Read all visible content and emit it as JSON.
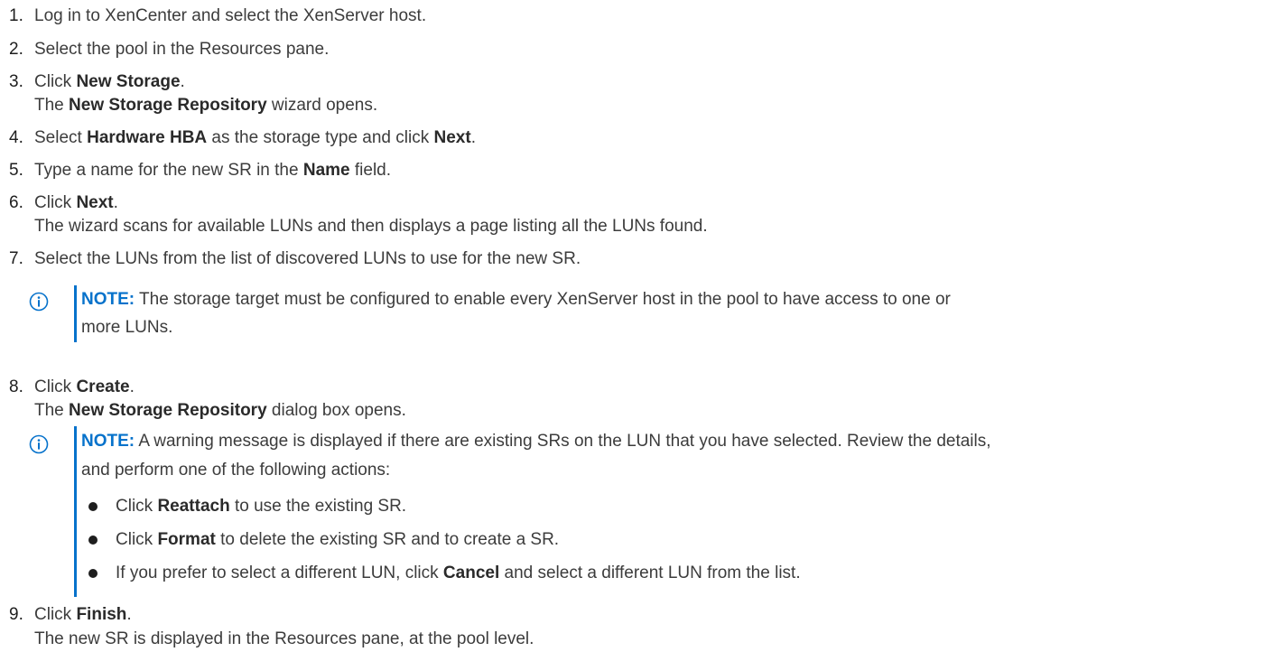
{
  "steps": [
    {
      "number": "1.",
      "text": "Log in to XenCenter and select the XenServer host."
    },
    {
      "number": "2.",
      "text": "Select the pool in the Resources pane."
    },
    {
      "number": "3.",
      "pre": "Click ",
      "bold": "New Storage",
      "post": ".",
      "sub": {
        "pre": "The ",
        "bold": "New Storage Repository",
        "post": " wizard opens."
      }
    },
    {
      "number": "4.",
      "pre": "Select ",
      "bold": "Hardware HBA",
      "mid": " as the storage type and click ",
      "bold2": "Next",
      "post": "."
    },
    {
      "number": "5.",
      "pre": "Type a name for the new SR in the ",
      "bold": "Name",
      "post": " field."
    },
    {
      "number": "6.",
      "pre": "Click ",
      "bold": "Next",
      "post": ".",
      "sub": "The wizard scans for available LUNs and then displays a page listing all the LUNs found."
    },
    {
      "number": "7.",
      "text": "Select the LUNs from the list of discovered LUNs to use for the new SR."
    },
    {
      "number": "8.",
      "pre": "Click ",
      "bold": "Create",
      "post": ".",
      "sub": {
        "pre": "The ",
        "bold": "New Storage Repository",
        "post": " dialog box opens."
      }
    },
    {
      "number": "9.",
      "pre": "Click ",
      "bold": "Finish",
      "post": ".",
      "sub": "The new SR is displayed in the Resources pane, at the pool level."
    }
  ],
  "note1": {
    "label": "NOTE:",
    "line1": " The storage target must be configured to enable every XenServer host in the pool to have access to one or",
    "line2": "more LUNs."
  },
  "note2": {
    "label": "NOTE:",
    "line1": " A warning message is displayed if there are existing SRs on the LUN that you have selected. Review the details,",
    "line2": "and perform one of the following actions:",
    "bullets": [
      {
        "pre": "Click ",
        "bold": "Reattach",
        "post": " to use the existing SR."
      },
      {
        "pre": "Click ",
        "bold": "Format",
        "post": " to delete the existing SR and to create a SR."
      },
      {
        "pre": "If you prefer to select a different LUN, click ",
        "bold": "Cancel",
        "post": " and select a different LUN from the list."
      }
    ]
  },
  "colors": {
    "accent": "#0672cb",
    "text": "#3c3c3c",
    "number": "#1e1e1e"
  },
  "icons": {
    "note": "info-circle-icon",
    "bullet": "bullet-dot-icon"
  }
}
